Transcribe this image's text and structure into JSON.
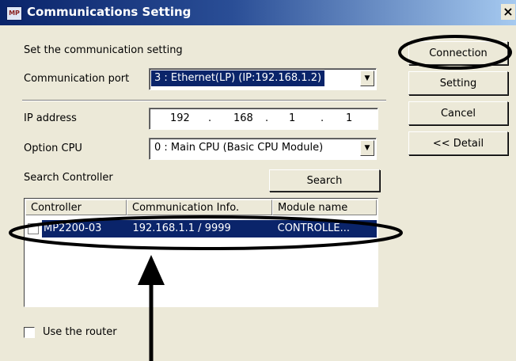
{
  "window": {
    "title": "Communications Setting",
    "close": "×",
    "icon_text": "MP"
  },
  "heading": "Set the communication setting",
  "port": {
    "label": "Communication port",
    "value": "3 : Ethernet(LP) (IP:192.168.1.2)"
  },
  "ip": {
    "label": "IP address",
    "octets": [
      "192",
      "168",
      "1",
      "1"
    ]
  },
  "cpu": {
    "label": "Option CPU",
    "value": "0 : Main CPU (Basic CPU Module)"
  },
  "search": {
    "label": "Search Controller",
    "button": "Search"
  },
  "list": {
    "columns": [
      "Controller",
      "Communication Info.",
      "Module name"
    ],
    "rows": [
      {
        "controller": "MP2200-03",
        "info": "192.168.1.1 / 9999",
        "module": "CONTROLLE..."
      }
    ]
  },
  "router": {
    "label": "Use the router"
  },
  "buttons": {
    "connection": "Connection",
    "setting": "Setting",
    "cancel": "Cancel",
    "detail": "<< Detail"
  },
  "colors": {
    "selection": "#0a246a",
    "dialog_bg": "#ece9d8",
    "annotation": "#000000"
  },
  "icons": {
    "dropdown": "▼"
  }
}
